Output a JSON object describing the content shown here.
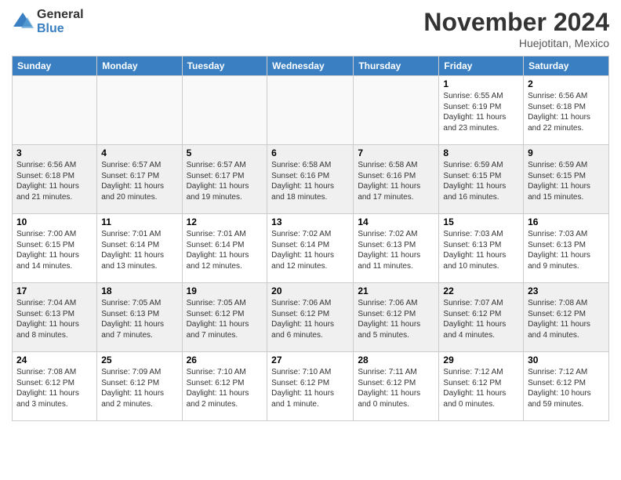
{
  "logo": {
    "general": "General",
    "blue": "Blue"
  },
  "title": "November 2024",
  "location": "Huejotitan, Mexico",
  "days_header": [
    "Sunday",
    "Monday",
    "Tuesday",
    "Wednesday",
    "Thursday",
    "Friday",
    "Saturday"
  ],
  "weeks": [
    [
      {
        "day": "",
        "info": ""
      },
      {
        "day": "",
        "info": ""
      },
      {
        "day": "",
        "info": ""
      },
      {
        "day": "",
        "info": ""
      },
      {
        "day": "",
        "info": ""
      },
      {
        "day": "1",
        "info": "Sunrise: 6:55 AM\nSunset: 6:19 PM\nDaylight: 11 hours and 23 minutes."
      },
      {
        "day": "2",
        "info": "Sunrise: 6:56 AM\nSunset: 6:18 PM\nDaylight: 11 hours and 22 minutes."
      }
    ],
    [
      {
        "day": "3",
        "info": "Sunrise: 6:56 AM\nSunset: 6:18 PM\nDaylight: 11 hours and 21 minutes."
      },
      {
        "day": "4",
        "info": "Sunrise: 6:57 AM\nSunset: 6:17 PM\nDaylight: 11 hours and 20 minutes."
      },
      {
        "day": "5",
        "info": "Sunrise: 6:57 AM\nSunset: 6:17 PM\nDaylight: 11 hours and 19 minutes."
      },
      {
        "day": "6",
        "info": "Sunrise: 6:58 AM\nSunset: 6:16 PM\nDaylight: 11 hours and 18 minutes."
      },
      {
        "day": "7",
        "info": "Sunrise: 6:58 AM\nSunset: 6:16 PM\nDaylight: 11 hours and 17 minutes."
      },
      {
        "day": "8",
        "info": "Sunrise: 6:59 AM\nSunset: 6:15 PM\nDaylight: 11 hours and 16 minutes."
      },
      {
        "day": "9",
        "info": "Sunrise: 6:59 AM\nSunset: 6:15 PM\nDaylight: 11 hours and 15 minutes."
      }
    ],
    [
      {
        "day": "10",
        "info": "Sunrise: 7:00 AM\nSunset: 6:15 PM\nDaylight: 11 hours and 14 minutes."
      },
      {
        "day": "11",
        "info": "Sunrise: 7:01 AM\nSunset: 6:14 PM\nDaylight: 11 hours and 13 minutes."
      },
      {
        "day": "12",
        "info": "Sunrise: 7:01 AM\nSunset: 6:14 PM\nDaylight: 11 hours and 12 minutes."
      },
      {
        "day": "13",
        "info": "Sunrise: 7:02 AM\nSunset: 6:14 PM\nDaylight: 11 hours and 12 minutes."
      },
      {
        "day": "14",
        "info": "Sunrise: 7:02 AM\nSunset: 6:13 PM\nDaylight: 11 hours and 11 minutes."
      },
      {
        "day": "15",
        "info": "Sunrise: 7:03 AM\nSunset: 6:13 PM\nDaylight: 11 hours and 10 minutes."
      },
      {
        "day": "16",
        "info": "Sunrise: 7:03 AM\nSunset: 6:13 PM\nDaylight: 11 hours and 9 minutes."
      }
    ],
    [
      {
        "day": "17",
        "info": "Sunrise: 7:04 AM\nSunset: 6:13 PM\nDaylight: 11 hours and 8 minutes."
      },
      {
        "day": "18",
        "info": "Sunrise: 7:05 AM\nSunset: 6:13 PM\nDaylight: 11 hours and 7 minutes."
      },
      {
        "day": "19",
        "info": "Sunrise: 7:05 AM\nSunset: 6:12 PM\nDaylight: 11 hours and 7 minutes."
      },
      {
        "day": "20",
        "info": "Sunrise: 7:06 AM\nSunset: 6:12 PM\nDaylight: 11 hours and 6 minutes."
      },
      {
        "day": "21",
        "info": "Sunrise: 7:06 AM\nSunset: 6:12 PM\nDaylight: 11 hours and 5 minutes."
      },
      {
        "day": "22",
        "info": "Sunrise: 7:07 AM\nSunset: 6:12 PM\nDaylight: 11 hours and 4 minutes."
      },
      {
        "day": "23",
        "info": "Sunrise: 7:08 AM\nSunset: 6:12 PM\nDaylight: 11 hours and 4 minutes."
      }
    ],
    [
      {
        "day": "24",
        "info": "Sunrise: 7:08 AM\nSunset: 6:12 PM\nDaylight: 11 hours and 3 minutes."
      },
      {
        "day": "25",
        "info": "Sunrise: 7:09 AM\nSunset: 6:12 PM\nDaylight: 11 hours and 2 minutes."
      },
      {
        "day": "26",
        "info": "Sunrise: 7:10 AM\nSunset: 6:12 PM\nDaylight: 11 hours and 2 minutes."
      },
      {
        "day": "27",
        "info": "Sunrise: 7:10 AM\nSunset: 6:12 PM\nDaylight: 11 hours and 1 minute."
      },
      {
        "day": "28",
        "info": "Sunrise: 7:11 AM\nSunset: 6:12 PM\nDaylight: 11 hours and 0 minutes."
      },
      {
        "day": "29",
        "info": "Sunrise: 7:12 AM\nSunset: 6:12 PM\nDaylight: 11 hours and 0 minutes."
      },
      {
        "day": "30",
        "info": "Sunrise: 7:12 AM\nSunset: 6:12 PM\nDaylight: 10 hours and 59 minutes."
      }
    ]
  ]
}
